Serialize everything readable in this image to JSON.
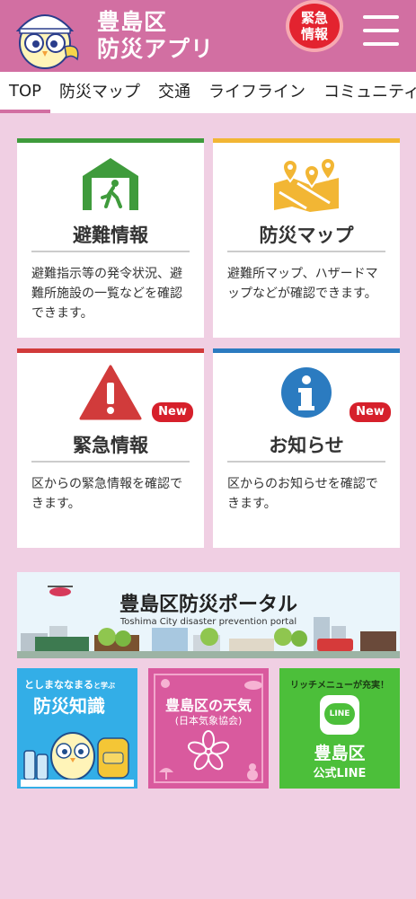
{
  "header": {
    "title_line1": "豊島区",
    "title_line2": "防災アプリ",
    "emergency_line1": "緊急",
    "emergency_line2": "情報"
  },
  "tabs": [
    {
      "label": "TOP"
    },
    {
      "label": "防災マップ"
    },
    {
      "label": "交通"
    },
    {
      "label": "ライフライン"
    },
    {
      "label": "コミュニティ"
    }
  ],
  "cards": [
    {
      "title": "避難情報",
      "desc": "避難指示等の発令状況、避難所施設の一覧などを確認できます。",
      "bar_color": "#3f9b3c"
    },
    {
      "title": "防災マップ",
      "desc": "避難所マップ、ハザードマップなどが確認できます。",
      "bar_color": "#f2b634"
    },
    {
      "title": "緊急情報",
      "desc": "区からの緊急情報を確認できます。",
      "bar_color": "#d13b3b",
      "badge": "New"
    },
    {
      "title": "お知らせ",
      "desc": "区からのお知らせを確認できます。",
      "bar_color": "#2b7bc0",
      "badge": "New"
    }
  ],
  "portal": {
    "title": "豊島区防災ポータル",
    "subtitle": "Toshima City disaster prevention portal"
  },
  "tiles": {
    "knowledge": {
      "top": "としまななまる",
      "small": "と学ぶ",
      "title": "防災知識"
    },
    "weather": {
      "title": "豊島区の天気",
      "sub": "(日本気象協会)"
    },
    "line": {
      "top": "リッチメニューが充実！",
      "logo": "LINE",
      "title": "豊島区",
      "sub": "公式LINE"
    }
  },
  "colors": {
    "header": "#d26fa2",
    "background": "#f0cfe3"
  }
}
